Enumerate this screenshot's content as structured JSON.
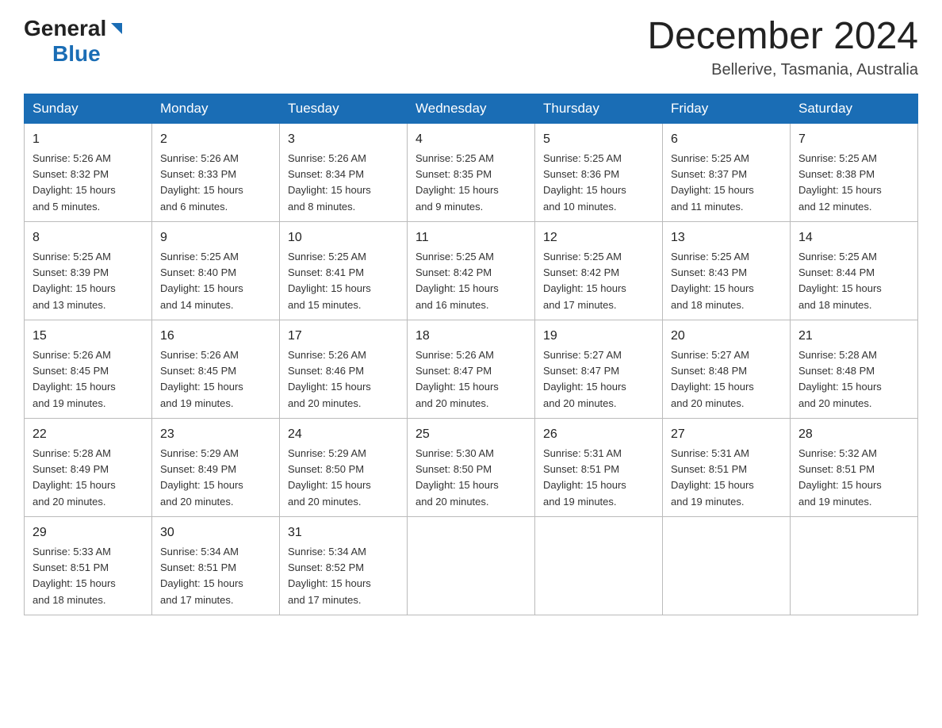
{
  "header": {
    "logo": {
      "general": "General",
      "blue": "Blue"
    },
    "title": "December 2024",
    "location": "Bellerive, Tasmania, Australia"
  },
  "days_of_week": [
    "Sunday",
    "Monday",
    "Tuesday",
    "Wednesday",
    "Thursday",
    "Friday",
    "Saturday"
  ],
  "weeks": [
    [
      {
        "day": "1",
        "sunrise": "5:26 AM",
        "sunset": "8:32 PM",
        "daylight": "15 hours and 5 minutes."
      },
      {
        "day": "2",
        "sunrise": "5:26 AM",
        "sunset": "8:33 PM",
        "daylight": "15 hours and 6 minutes."
      },
      {
        "day": "3",
        "sunrise": "5:26 AM",
        "sunset": "8:34 PM",
        "daylight": "15 hours and 8 minutes."
      },
      {
        "day": "4",
        "sunrise": "5:25 AM",
        "sunset": "8:35 PM",
        "daylight": "15 hours and 9 minutes."
      },
      {
        "day": "5",
        "sunrise": "5:25 AM",
        "sunset": "8:36 PM",
        "daylight": "15 hours and 10 minutes."
      },
      {
        "day": "6",
        "sunrise": "5:25 AM",
        "sunset": "8:37 PM",
        "daylight": "15 hours and 11 minutes."
      },
      {
        "day": "7",
        "sunrise": "5:25 AM",
        "sunset": "8:38 PM",
        "daylight": "15 hours and 12 minutes."
      }
    ],
    [
      {
        "day": "8",
        "sunrise": "5:25 AM",
        "sunset": "8:39 PM",
        "daylight": "15 hours and 13 minutes."
      },
      {
        "day": "9",
        "sunrise": "5:25 AM",
        "sunset": "8:40 PM",
        "daylight": "15 hours and 14 minutes."
      },
      {
        "day": "10",
        "sunrise": "5:25 AM",
        "sunset": "8:41 PM",
        "daylight": "15 hours and 15 minutes."
      },
      {
        "day": "11",
        "sunrise": "5:25 AM",
        "sunset": "8:42 PM",
        "daylight": "15 hours and 16 minutes."
      },
      {
        "day": "12",
        "sunrise": "5:25 AM",
        "sunset": "8:42 PM",
        "daylight": "15 hours and 17 minutes."
      },
      {
        "day": "13",
        "sunrise": "5:25 AM",
        "sunset": "8:43 PM",
        "daylight": "15 hours and 18 minutes."
      },
      {
        "day": "14",
        "sunrise": "5:25 AM",
        "sunset": "8:44 PM",
        "daylight": "15 hours and 18 minutes."
      }
    ],
    [
      {
        "day": "15",
        "sunrise": "5:26 AM",
        "sunset": "8:45 PM",
        "daylight": "15 hours and 19 minutes."
      },
      {
        "day": "16",
        "sunrise": "5:26 AM",
        "sunset": "8:45 PM",
        "daylight": "15 hours and 19 minutes."
      },
      {
        "day": "17",
        "sunrise": "5:26 AM",
        "sunset": "8:46 PM",
        "daylight": "15 hours and 20 minutes."
      },
      {
        "day": "18",
        "sunrise": "5:26 AM",
        "sunset": "8:47 PM",
        "daylight": "15 hours and 20 minutes."
      },
      {
        "day": "19",
        "sunrise": "5:27 AM",
        "sunset": "8:47 PM",
        "daylight": "15 hours and 20 minutes."
      },
      {
        "day": "20",
        "sunrise": "5:27 AM",
        "sunset": "8:48 PM",
        "daylight": "15 hours and 20 minutes."
      },
      {
        "day": "21",
        "sunrise": "5:28 AM",
        "sunset": "8:48 PM",
        "daylight": "15 hours and 20 minutes."
      }
    ],
    [
      {
        "day": "22",
        "sunrise": "5:28 AM",
        "sunset": "8:49 PM",
        "daylight": "15 hours and 20 minutes."
      },
      {
        "day": "23",
        "sunrise": "5:29 AM",
        "sunset": "8:49 PM",
        "daylight": "15 hours and 20 minutes."
      },
      {
        "day": "24",
        "sunrise": "5:29 AM",
        "sunset": "8:50 PM",
        "daylight": "15 hours and 20 minutes."
      },
      {
        "day": "25",
        "sunrise": "5:30 AM",
        "sunset": "8:50 PM",
        "daylight": "15 hours and 20 minutes."
      },
      {
        "day": "26",
        "sunrise": "5:31 AM",
        "sunset": "8:51 PM",
        "daylight": "15 hours and 19 minutes."
      },
      {
        "day": "27",
        "sunrise": "5:31 AM",
        "sunset": "8:51 PM",
        "daylight": "15 hours and 19 minutes."
      },
      {
        "day": "28",
        "sunrise": "5:32 AM",
        "sunset": "8:51 PM",
        "daylight": "15 hours and 19 minutes."
      }
    ],
    [
      {
        "day": "29",
        "sunrise": "5:33 AM",
        "sunset": "8:51 PM",
        "daylight": "15 hours and 18 minutes."
      },
      {
        "day": "30",
        "sunrise": "5:34 AM",
        "sunset": "8:51 PM",
        "daylight": "15 hours and 17 minutes."
      },
      {
        "day": "31",
        "sunrise": "5:34 AM",
        "sunset": "8:52 PM",
        "daylight": "15 hours and 17 minutes."
      },
      null,
      null,
      null,
      null
    ]
  ],
  "labels": {
    "sunrise": "Sunrise:",
    "sunset": "Sunset:",
    "daylight": "Daylight:"
  }
}
